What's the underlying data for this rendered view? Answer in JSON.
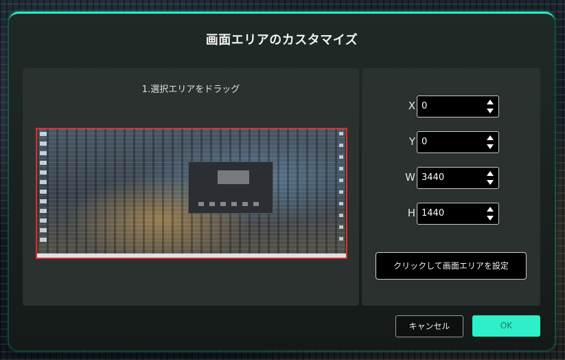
{
  "dialog": {
    "title": "画面エリアのカスタマイズ",
    "accent_color": "#2ee8c8",
    "left": {
      "instruction": "1.選択エリアをドラッグ",
      "selection_color": "#e02a2a"
    },
    "fields": [
      {
        "label": "X",
        "value": "0"
      },
      {
        "label": "Y",
        "value": "0"
      },
      {
        "label": "W",
        "value": "3440"
      },
      {
        "label": "H",
        "value": "1440"
      }
    ],
    "set_area_button": "クリックして画面エリアを設定",
    "cancel_button": "キャンセル",
    "ok_button": "OK"
  }
}
